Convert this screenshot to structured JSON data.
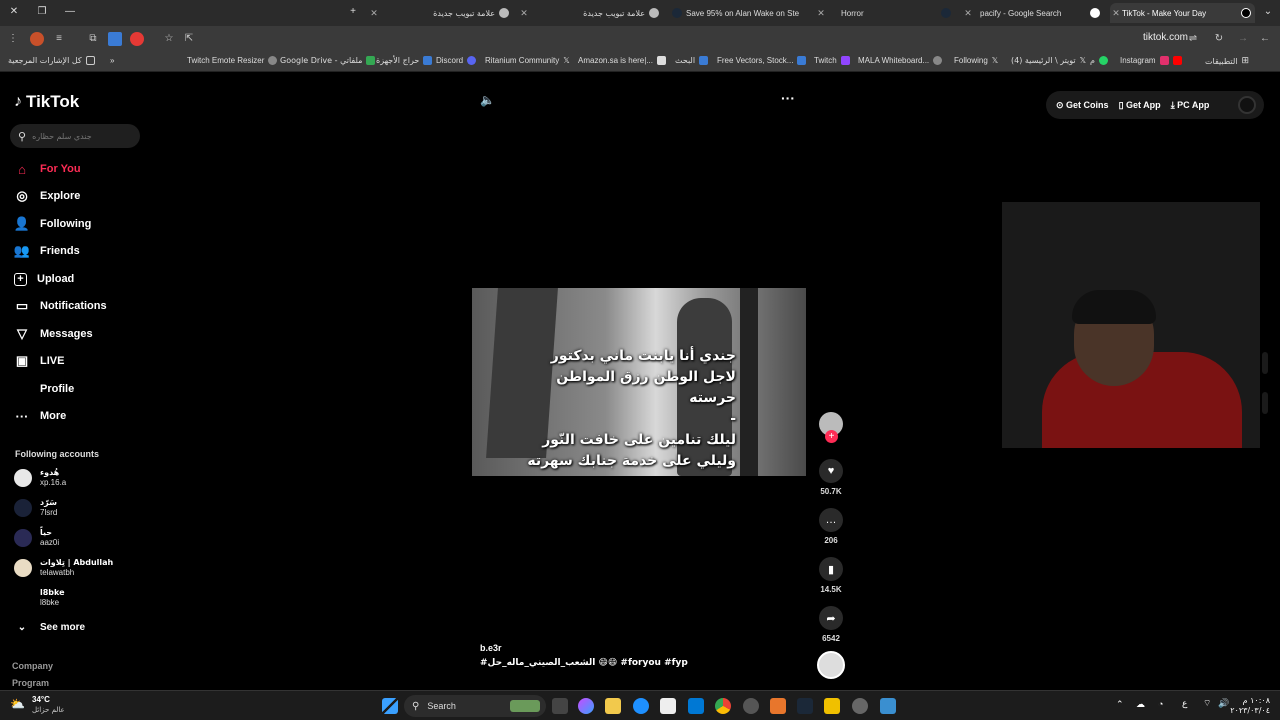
{
  "browser": {
    "tabs": [
      {
        "label": "علامة تبويب جديدة"
      },
      {
        "label": "علامة تبويب جديدة"
      },
      {
        "label": "Save 95% on Alan Wake on Ste"
      },
      {
        "label": "Horror"
      },
      {
        "label": "pacify - Google Search"
      },
      {
        "label": "TikTok - Make Your Day"
      }
    ],
    "url": "tiktok.com",
    "bookmarks": [
      {
        "label": "كل الإشارات المرجعية",
        "color": "#888"
      },
      {
        "label": "Twitch Emote Resizer",
        "color": "#888"
      },
      {
        "label": "Google Drive - ملفاتي",
        "color": "#34a853"
      },
      {
        "label": "حراج الأجهزة",
        "color": "#3a7bd5"
      },
      {
        "label": "Discord",
        "color": "#5865f2"
      },
      {
        "label": "Ritanium Community",
        "color": "#555"
      },
      {
        "label": "Amazon.sa is here|...",
        "color": "#ddd"
      },
      {
        "label": "البحث",
        "color": "#3a7bd5"
      },
      {
        "label": "Free Vectors, Stock...",
        "color": "#3a7bd5"
      },
      {
        "label": "Twitch",
        "color": "#9146ff"
      },
      {
        "label": "MALA Whiteboard...",
        "color": "#888"
      },
      {
        "label": "Following",
        "color": "#333"
      },
      {
        "label": "(4) تويتر \\ الرئيسية",
        "color": "#333"
      },
      {
        "label": "م",
        "color": "#25d366"
      },
      {
        "label": "Instagram",
        "color": "#e1306c"
      },
      {
        "label": "التطبيقات",
        "color": "#888"
      }
    ]
  },
  "brand": {
    "name": "TikTok"
  },
  "search": {
    "placeholder": "جندي سلم حظاره"
  },
  "nav": [
    {
      "label": "For You",
      "icon": "home-icon"
    },
    {
      "label": "Explore",
      "icon": "compass-icon"
    },
    {
      "label": "Following",
      "icon": "following-icon"
    },
    {
      "label": "Friends",
      "icon": "friends-icon"
    },
    {
      "label": "Upload",
      "icon": "upload-icon"
    },
    {
      "label": "Notifications",
      "icon": "notifications-icon"
    },
    {
      "label": "Messages",
      "icon": "messages-icon"
    },
    {
      "label": "LIVE",
      "icon": "live-icon"
    },
    {
      "label": "Profile",
      "icon": "profile-icon"
    },
    {
      "label": "More",
      "icon": "more-icon"
    }
  ],
  "following": {
    "title": "Following accounts",
    "accounts": [
      {
        "name": "هُدوء",
        "user": "xp.16.a"
      },
      {
        "name": "سَرّد",
        "user": "7lsrd"
      },
      {
        "name": "حياً",
        "user": "aaz0i"
      },
      {
        "name": "تِلاوات | Abdullah",
        "user": "telawatbh"
      },
      {
        "name": "l8bke",
        "user": "l8bke"
      }
    ],
    "see_more": "See more"
  },
  "footer": {
    "company": "Company",
    "program": "Program"
  },
  "topbar": {
    "coins": "Get Coins",
    "app": "Get App",
    "pc": "PC App"
  },
  "video": {
    "caption_lines": [
      "جندي أنا يابنت ماني بدكتور",
      "لاجل الوطن رزق المواطن حرسته",
      "-",
      "ليلك تنامين على خافت النّور",
      "وليلي على خدمة جنابك سهرته"
    ],
    "author": "b.e3r",
    "tags": "#الشعب_الصيني_ماله_حل 😄😄 #foryou  #fyp"
  },
  "actions": {
    "likes": "50.7K",
    "comments": "206",
    "saves": "14.5K",
    "shares": "6542"
  },
  "taskbar": {
    "weather_temp": "34°C",
    "weather_desc": "عالم حزائل",
    "search": "Search",
    "lang": "ع",
    "time": "١٠:٠٨ م",
    "date": "٢٠٢٣/٠٣/٠٤"
  },
  "colors": {
    "accent": "#fe2c55"
  }
}
